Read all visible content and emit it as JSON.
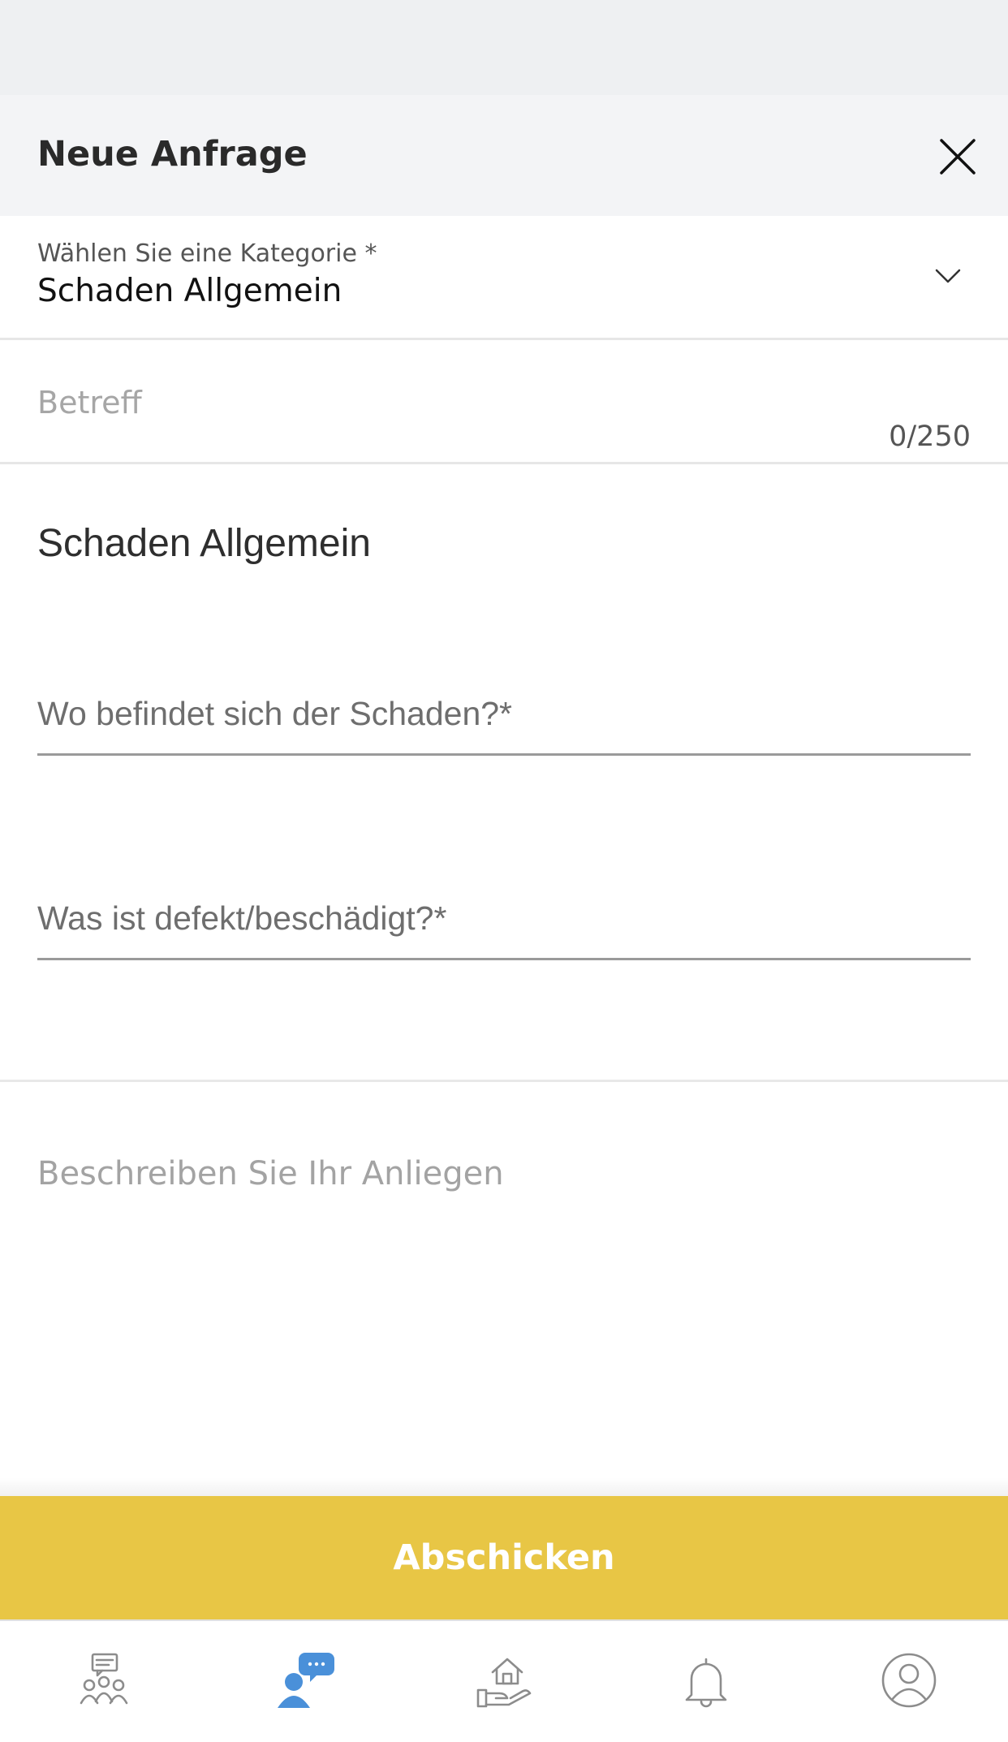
{
  "header": {
    "title": "Neue Anfrage",
    "close_icon": "close-icon"
  },
  "category": {
    "label": "Wählen Sie eine Kategorie *",
    "value": "Schaden Allgemein",
    "chevron_icon": "chevron-down-icon"
  },
  "subject": {
    "value": "",
    "placeholder": "Betreff",
    "counter": "0/250"
  },
  "form": {
    "heading": "Schaden Allgemein",
    "where": {
      "value": "",
      "placeholder": "Wo befindet sich der Schaden?*"
    },
    "what": {
      "value": "",
      "placeholder": "Was ist defekt/beschädigt?*"
    }
  },
  "description": {
    "value": "",
    "placeholder": "Beschreiben Sie Ihr Anliegen"
  },
  "submit": {
    "label": "Abschicken"
  },
  "tabbar": {
    "active_index": 1,
    "items": [
      {
        "icon": "community-icon"
      },
      {
        "icon": "support-chat-icon"
      },
      {
        "icon": "house-service-icon"
      },
      {
        "icon": "bell-icon"
      },
      {
        "icon": "profile-icon"
      }
    ]
  },
  "colors": {
    "accent": "#e8c645",
    "active_tab": "#4a90d9",
    "inactive_tab": "#8c8c8c",
    "header_bg": "#f3f4f6"
  }
}
